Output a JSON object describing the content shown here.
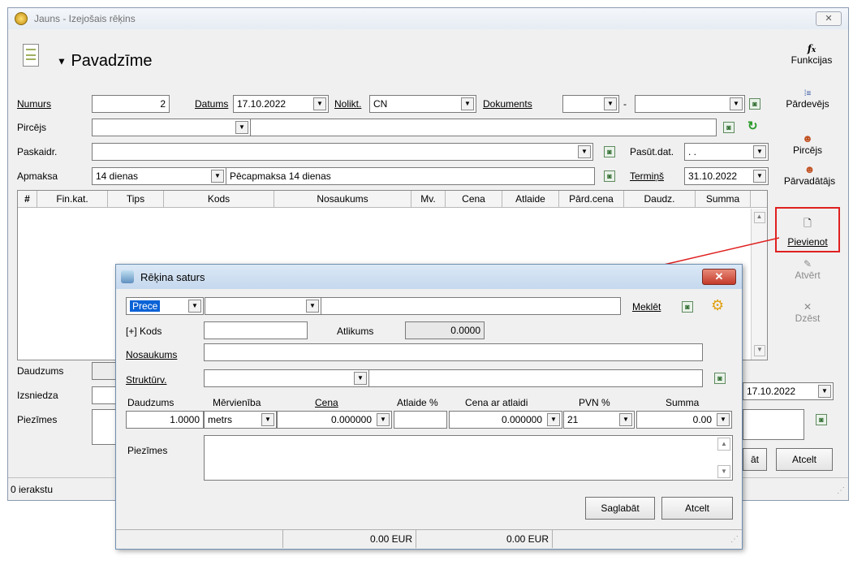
{
  "window": {
    "title": "Jauns - Izejošais rēķins",
    "close_icon": "close-icon",
    "doc_type": "Pavadzīme",
    "functions_label": "Funkcijas"
  },
  "form": {
    "numurs_label": "Numurs",
    "numurs_value": "2",
    "datums_label": "Datums",
    "datums_value": "17.10.2022",
    "nolikt_label": "Nolikt.",
    "nolikt_value": "CN",
    "dokuments_label": "Dokuments",
    "dokuments_sep": "-",
    "pircejs_label": "Pircējs",
    "pircejs_value": "",
    "paskaidr_label": "Paskaidr.",
    "paskaidr_value": "",
    "pasut_dat_label": "Pasūt.dat.",
    "pasut_dat_value": ". .",
    "apmaksa_label": "Apmaksa",
    "apmaksa_value": "14 dienas",
    "apmaksa_desc": "Pēcapmaksa 14 dienas",
    "termins_label": "Termiņš",
    "termins_value": "31.10.2022"
  },
  "grid": {
    "columns": [
      "#",
      "Fin.kat.",
      "Tips",
      "Kods",
      "Nosaukums",
      "Mv.",
      "Cena",
      "Atlaide",
      "Pārd.cena",
      "Daudz.",
      "Summa"
    ]
  },
  "lower": {
    "daudzums_label": "Daudzums",
    "izsniedza_label": "Izsniedza",
    "piezimes_label": "Piezīmes",
    "date_value": "17.10.2022",
    "save_partial": "āt",
    "cancel_label": "Atcelt",
    "status": "0 ierakstu"
  },
  "side": {
    "seller_label": "Pārdevējs",
    "buyer_label": "Pircējs",
    "carrier_label": "Pārvadātājs",
    "add_label": "Pievienot",
    "open_label": "Atvērt",
    "delete_label": "Dzēst"
  },
  "dialog": {
    "title": "Rēķina saturs",
    "type_value": "Prece",
    "search_label": "Meklēt",
    "kods_label": "[+] Kods",
    "atlikums_label": "Atlikums",
    "atlikums_value": "0.0000",
    "nosaukums_label": "Nosaukums",
    "strukturv_label": "Struktūrv.",
    "headers": {
      "daudzums": "Daudzums",
      "mervieniba": "Mērvienība",
      "cena": "Cena",
      "atlaide": "Atlaide %",
      "cena_atl": "Cena ar atlaidi",
      "pvn": "PVN %",
      "summa": "Summa"
    },
    "values": {
      "daudzums": "1.0000",
      "mervieniba": "metrs",
      "cena": "0.000000",
      "atlaide": "",
      "cena_atl": "0.000000",
      "pvn": "21",
      "summa": "0.00"
    },
    "piezimes_label": "Piezīmes",
    "save_label": "Saglabāt",
    "cancel_label": "Atcelt",
    "status_total1": "0.00 EUR",
    "status_total2": "0.00 EUR"
  },
  "colors": {
    "highlight_red": "#e02020",
    "selection_blue": "#0a62d6"
  }
}
